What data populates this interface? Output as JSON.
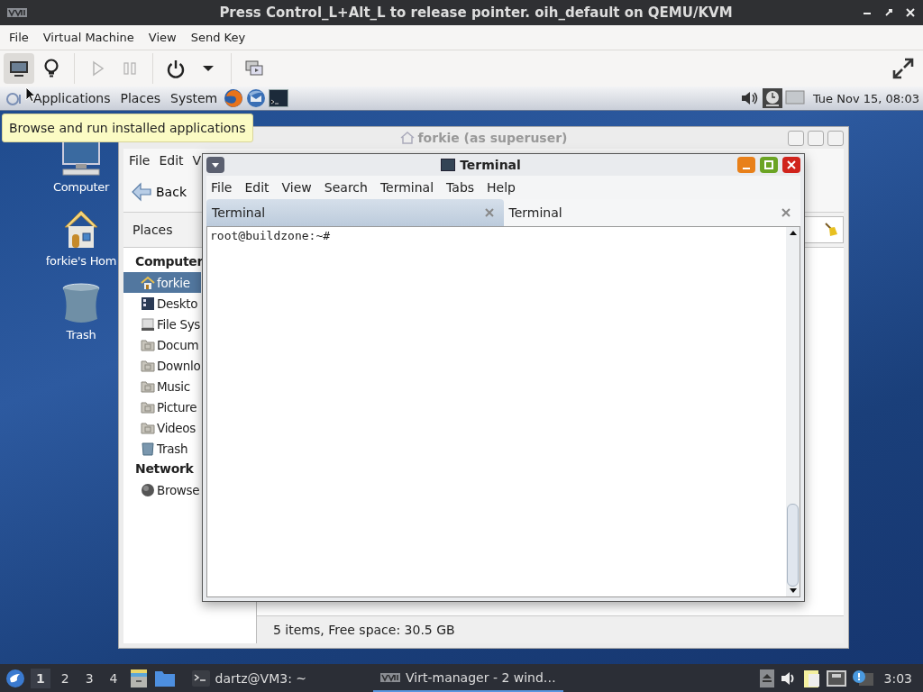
{
  "host_window": {
    "title": "Press Control_L+Alt_L to release pointer. oih_default on QEMU/KVM",
    "menu": [
      "File",
      "Virtual Machine",
      "View",
      "Send Key"
    ],
    "toolbar": [
      {
        "kind": "display",
        "selected": true,
        "disabled": false
      },
      {
        "kind": "details",
        "selected": false,
        "disabled": false
      },
      {
        "kind": "run",
        "selected": false,
        "disabled": true
      },
      {
        "kind": "pause",
        "selected": false,
        "disabled": true
      },
      {
        "kind": "shutdown",
        "selected": false,
        "disabled": false
      },
      {
        "kind": "dropdown",
        "selected": false,
        "disabled": false
      },
      {
        "kind": "snapshots",
        "selected": false,
        "disabled": false
      }
    ]
  },
  "guest_panel": {
    "menu": [
      "Applications",
      "Places",
      "System"
    ],
    "clock": "Tue Nov 15, 08:03"
  },
  "tooltip": "Browse and run installed applications",
  "desktop_icons": [
    {
      "kind": "computer",
      "label": "Computer"
    },
    {
      "kind": "home",
      "label": "forkie's Hom"
    },
    {
      "kind": "trash",
      "label": "Trash"
    }
  ],
  "file_manager": {
    "title": "forkie (as superuser)",
    "menu": [
      "File",
      "Edit",
      "V"
    ],
    "back": "Back",
    "places_label": "Places",
    "sections": [
      {
        "heading": "Computer",
        "items": [
          {
            "kind": "home",
            "label": "forkie",
            "selected": true
          },
          {
            "kind": "desktop",
            "label": "Deskto",
            "selected": false
          },
          {
            "kind": "drive",
            "label": "File Sys",
            "selected": false
          },
          {
            "kind": "folder",
            "label": "Docum",
            "selected": false
          },
          {
            "kind": "folder",
            "label": "Downlo",
            "selected": false
          },
          {
            "kind": "folder",
            "label": "Music",
            "selected": false
          },
          {
            "kind": "folder",
            "label": "Picture",
            "selected": false
          },
          {
            "kind": "folder",
            "label": "Videos",
            "selected": false
          },
          {
            "kind": "trash",
            "label": "Trash",
            "selected": false
          }
        ]
      },
      {
        "heading": "Network",
        "items": [
          {
            "kind": "network",
            "label": "Browse",
            "selected": false
          }
        ]
      }
    ],
    "status": "5 items, Free space: 30.5 GB"
  },
  "terminal": {
    "title": "Terminal",
    "menu": [
      "File",
      "Edit",
      "View",
      "Search",
      "Terminal",
      "Tabs",
      "Help"
    ],
    "tabs": [
      {
        "label": "Terminal",
        "selected": true
      },
      {
        "label": "Terminal",
        "selected": false
      }
    ],
    "lines": [
      "root@buildzone:~#"
    ]
  },
  "taskbar": {
    "workspaces": [
      {
        "label": "1",
        "selected": true
      },
      {
        "label": "2",
        "selected": false
      },
      {
        "label": "3",
        "selected": false
      },
      {
        "label": "4",
        "selected": false
      }
    ],
    "tasks": [
      {
        "kind": "terminal",
        "label": "dartz@VM3: ~",
        "selected": false
      },
      {
        "kind": "vm",
        "label": "Virt-manager - 2 wind…",
        "selected": true
      }
    ],
    "clock": "3:03"
  }
}
